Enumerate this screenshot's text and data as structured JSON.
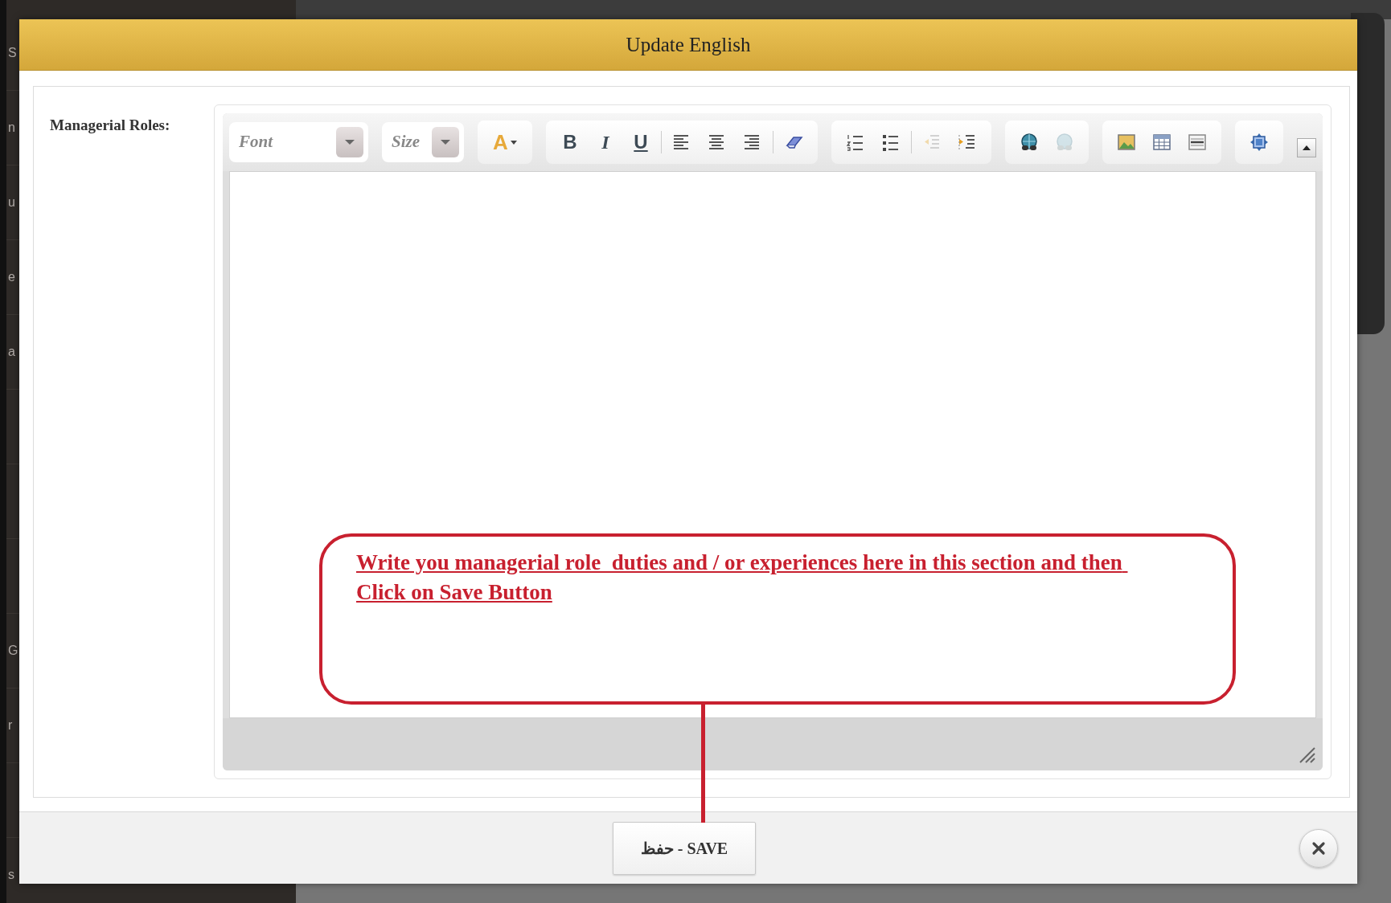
{
  "sidebar_fragments": [
    "S",
    "n",
    "u",
    "e",
    "a",
    "G",
    "r",
    "s"
  ],
  "dialog": {
    "title": "Update English",
    "field": {
      "label": "Managerial Roles:"
    },
    "toolbar": [
      {
        "kind": "select",
        "label": "Font",
        "wide": true
      },
      {
        "kind": "select",
        "label": "Size",
        "wide": false
      },
      {
        "kind": "group",
        "sections": [
          [
            {
              "kind": "text-color",
              "label": "A",
              "disabled": false
            }
          ]
        ]
      },
      {
        "kind": "group",
        "sections": [
          [
            {
              "kind": "bold",
              "label": "B",
              "disabled": false
            },
            {
              "kind": "italic",
              "label": "I",
              "disabled": false
            },
            {
              "kind": "underline",
              "label": "U",
              "disabled": false
            }
          ],
          [
            {
              "kind": "align-left",
              "disabled": false
            },
            {
              "kind": "align-center",
              "disabled": false
            },
            {
              "kind": "align-right",
              "disabled": false
            }
          ],
          [
            {
              "kind": "eraser",
              "disabled": false
            }
          ]
        ]
      },
      {
        "kind": "group",
        "sections": [
          [
            {
              "kind": "ordered-list",
              "disabled": false
            },
            {
              "kind": "bullet-list",
              "disabled": false
            }
          ],
          [
            {
              "kind": "outdent",
              "disabled": true
            },
            {
              "kind": "indent",
              "disabled": false
            }
          ]
        ]
      },
      {
        "kind": "group",
        "sections": [
          [
            {
              "kind": "link",
              "disabled": false
            },
            {
              "kind": "unlink",
              "disabled": true
            }
          ]
        ]
      },
      {
        "kind": "group",
        "sections": [
          [
            {
              "kind": "image",
              "disabled": false
            },
            {
              "kind": "table",
              "disabled": false
            },
            {
              "kind": "rule",
              "disabled": false
            }
          ]
        ]
      },
      {
        "kind": "group",
        "sections": [
          [
            {
              "kind": "source",
              "disabled": false
            }
          ]
        ]
      },
      {
        "kind": "collapse"
      }
    ],
    "annotation": {
      "text": "Write you managerial role  duties and / or experiences here in this section and then Click on Save Button"
    },
    "save_button": {
      "label": "حفظ - SAVE"
    }
  }
}
